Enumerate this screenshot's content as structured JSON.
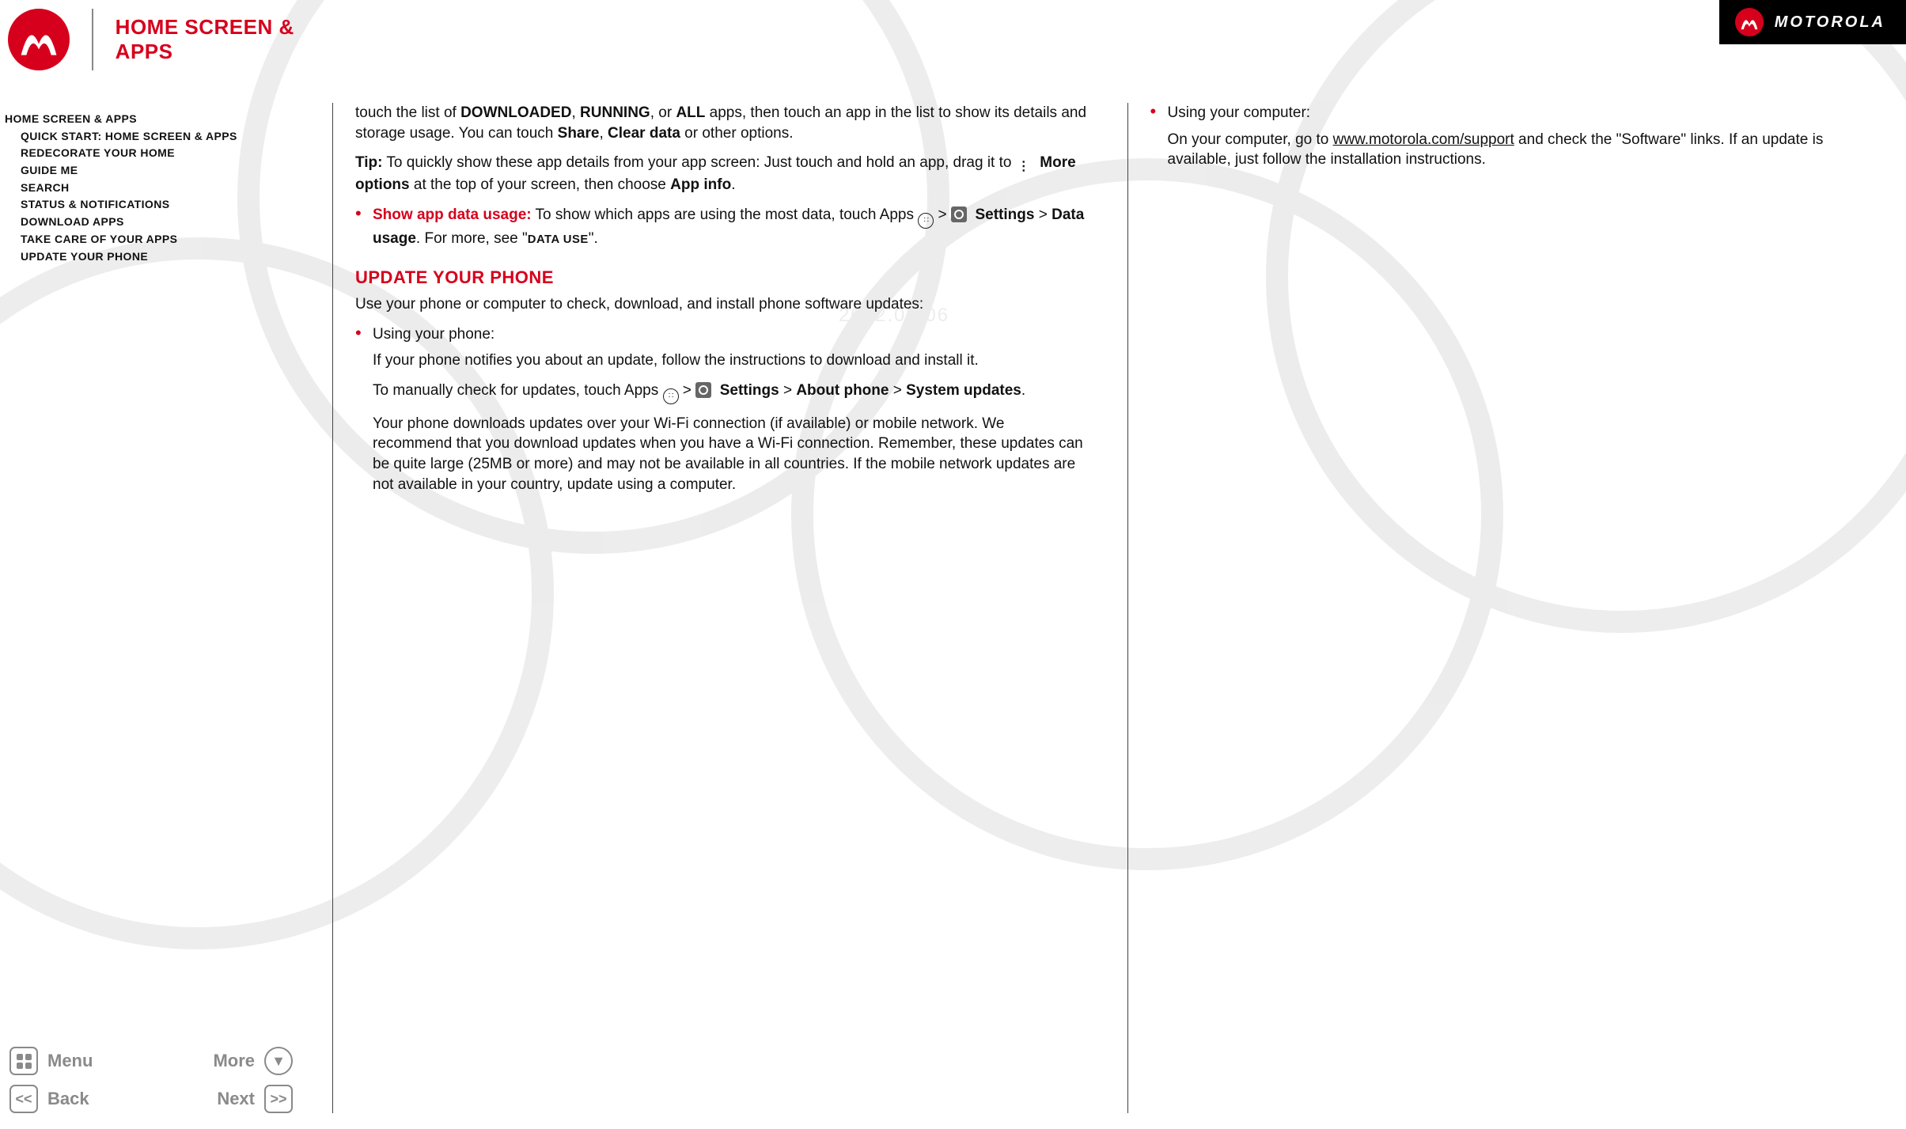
{
  "brand": "MOTOROLA",
  "page_title": "HOME SCREEN & APPS",
  "watermark_date": "2012.09.06",
  "sidebar": {
    "heading": "HOME SCREEN & APPS",
    "items": [
      "QUICK START: HOME SCREEN & APPS",
      "REDECORATE YOUR HOME",
      "GUIDE ME",
      "SEARCH",
      "STATUS & NOTIFICATIONS",
      "DOWNLOAD APPS",
      "TAKE CARE OF YOUR APPS",
      "UPDATE YOUR PHONE"
    ]
  },
  "footer": {
    "menu": "Menu",
    "more": "More",
    "back": "Back",
    "next": "Next"
  },
  "content": {
    "col1": {
      "p1a": "touch the list of ",
      "p1_downloaded": "DOWNLOADED",
      "p1b": ", ",
      "p1_running": "RUNNING",
      "p1c": ", or ",
      "p1_all": "ALL",
      "p1d": " apps, then touch an app in the list to show its details and storage usage. You can touch ",
      "p1_share": "Share",
      "p1e": ", ",
      "p1_clear": "Clear data",
      "p1f": " or other options.",
      "tip_label": "Tip:",
      "tip_a": " To quickly show these app details from your app screen: Just touch and hold an app, drag it to ",
      "tip_more": "More options",
      "tip_b": " at the top of your screen, then choose ",
      "tip_appinfo": "App info",
      "tip_c": ".",
      "li_label": "Show app data usage:",
      "li_a": " To show which apps are using the most data, touch Apps ",
      "li_gt1": " > ",
      "li_settings": "Settings",
      "li_gt2": " > ",
      "li_datausage": "Data usage",
      "li_b": ". For more, see \"",
      "li_datause_ref": "DATA USE",
      "li_c": "\".",
      "h_update": "UPDATE YOUR PHONE",
      "upd_intro": "Use your phone or computer to check, download, and install phone software updates:",
      "phone_label": "Using your phone:",
      "phone_p1": "If your phone notifies you about an update, follow the instructions to download and install it.",
      "phone_p2a": "To manually check for updates, touch Apps ",
      "phone_p2_gt1": " > ",
      "phone_p2_settings": "Settings",
      "phone_p2_gt2": " > ",
      "phone_p2_about": "About phone",
      "phone_p2_gt3": " > ",
      "phone_p2_sys": "System updates",
      "phone_p2b": ".",
      "phone_p3": "Your phone downloads updates over your Wi-Fi connection (if available) or mobile network. We recommend that you download updates when you have a Wi-Fi connection. Remember, these updates can be quite large (25MB or more) and may not be available in all countries. If the mobile network updates are not available in your country, update using a computer."
    },
    "col2": {
      "comp_label": "Using your computer:",
      "comp_a": "On your computer, go to ",
      "comp_link": "www.motorola.com/support",
      "comp_b": " and check the \"Software\" links. If an update is available, just follow the installation instructions."
    }
  }
}
